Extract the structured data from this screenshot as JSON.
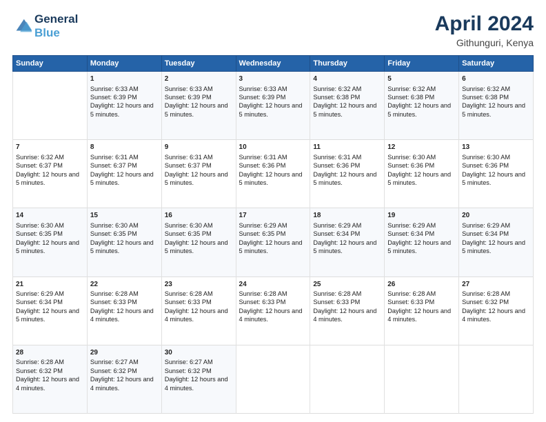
{
  "header": {
    "logo_line1": "General",
    "logo_line2": "Blue",
    "title": "April 2024",
    "subtitle": "Githunguri, Kenya"
  },
  "columns": [
    "Sunday",
    "Monday",
    "Tuesday",
    "Wednesday",
    "Thursday",
    "Friday",
    "Saturday"
  ],
  "weeks": [
    [
      {
        "day": "",
        "sunrise": "",
        "sunset": "",
        "daylight": ""
      },
      {
        "day": "1",
        "sunrise": "Sunrise: 6:33 AM",
        "sunset": "Sunset: 6:39 PM",
        "daylight": "Daylight: 12 hours and 5 minutes."
      },
      {
        "day": "2",
        "sunrise": "Sunrise: 6:33 AM",
        "sunset": "Sunset: 6:39 PM",
        "daylight": "Daylight: 12 hours and 5 minutes."
      },
      {
        "day": "3",
        "sunrise": "Sunrise: 6:33 AM",
        "sunset": "Sunset: 6:39 PM",
        "daylight": "Daylight: 12 hours and 5 minutes."
      },
      {
        "day": "4",
        "sunrise": "Sunrise: 6:32 AM",
        "sunset": "Sunset: 6:38 PM",
        "daylight": "Daylight: 12 hours and 5 minutes."
      },
      {
        "day": "5",
        "sunrise": "Sunrise: 6:32 AM",
        "sunset": "Sunset: 6:38 PM",
        "daylight": "Daylight: 12 hours and 5 minutes."
      },
      {
        "day": "6",
        "sunrise": "Sunrise: 6:32 AM",
        "sunset": "Sunset: 6:38 PM",
        "daylight": "Daylight: 12 hours and 5 minutes."
      }
    ],
    [
      {
        "day": "7",
        "sunrise": "Sunrise: 6:32 AM",
        "sunset": "Sunset: 6:37 PM",
        "daylight": "Daylight: 12 hours and 5 minutes."
      },
      {
        "day": "8",
        "sunrise": "Sunrise: 6:31 AM",
        "sunset": "Sunset: 6:37 PM",
        "daylight": "Daylight: 12 hours and 5 minutes."
      },
      {
        "day": "9",
        "sunrise": "Sunrise: 6:31 AM",
        "sunset": "Sunset: 6:37 PM",
        "daylight": "Daylight: 12 hours and 5 minutes."
      },
      {
        "day": "10",
        "sunrise": "Sunrise: 6:31 AM",
        "sunset": "Sunset: 6:36 PM",
        "daylight": "Daylight: 12 hours and 5 minutes."
      },
      {
        "day": "11",
        "sunrise": "Sunrise: 6:31 AM",
        "sunset": "Sunset: 6:36 PM",
        "daylight": "Daylight: 12 hours and 5 minutes."
      },
      {
        "day": "12",
        "sunrise": "Sunrise: 6:30 AM",
        "sunset": "Sunset: 6:36 PM",
        "daylight": "Daylight: 12 hours and 5 minutes."
      },
      {
        "day": "13",
        "sunrise": "Sunrise: 6:30 AM",
        "sunset": "Sunset: 6:36 PM",
        "daylight": "Daylight: 12 hours and 5 minutes."
      }
    ],
    [
      {
        "day": "14",
        "sunrise": "Sunrise: 6:30 AM",
        "sunset": "Sunset: 6:35 PM",
        "daylight": "Daylight: 12 hours and 5 minutes."
      },
      {
        "day": "15",
        "sunrise": "Sunrise: 6:30 AM",
        "sunset": "Sunset: 6:35 PM",
        "daylight": "Daylight: 12 hours and 5 minutes."
      },
      {
        "day": "16",
        "sunrise": "Sunrise: 6:30 AM",
        "sunset": "Sunset: 6:35 PM",
        "daylight": "Daylight: 12 hours and 5 minutes."
      },
      {
        "day": "17",
        "sunrise": "Sunrise: 6:29 AM",
        "sunset": "Sunset: 6:35 PM",
        "daylight": "Daylight: 12 hours and 5 minutes."
      },
      {
        "day": "18",
        "sunrise": "Sunrise: 6:29 AM",
        "sunset": "Sunset: 6:34 PM",
        "daylight": "Daylight: 12 hours and 5 minutes."
      },
      {
        "day": "19",
        "sunrise": "Sunrise: 6:29 AM",
        "sunset": "Sunset: 6:34 PM",
        "daylight": "Daylight: 12 hours and 5 minutes."
      },
      {
        "day": "20",
        "sunrise": "Sunrise: 6:29 AM",
        "sunset": "Sunset: 6:34 PM",
        "daylight": "Daylight: 12 hours and 5 minutes."
      }
    ],
    [
      {
        "day": "21",
        "sunrise": "Sunrise: 6:29 AM",
        "sunset": "Sunset: 6:34 PM",
        "daylight": "Daylight: 12 hours and 5 minutes."
      },
      {
        "day": "22",
        "sunrise": "Sunrise: 6:28 AM",
        "sunset": "Sunset: 6:33 PM",
        "daylight": "Daylight: 12 hours and 4 minutes."
      },
      {
        "day": "23",
        "sunrise": "Sunrise: 6:28 AM",
        "sunset": "Sunset: 6:33 PM",
        "daylight": "Daylight: 12 hours and 4 minutes."
      },
      {
        "day": "24",
        "sunrise": "Sunrise: 6:28 AM",
        "sunset": "Sunset: 6:33 PM",
        "daylight": "Daylight: 12 hours and 4 minutes."
      },
      {
        "day": "25",
        "sunrise": "Sunrise: 6:28 AM",
        "sunset": "Sunset: 6:33 PM",
        "daylight": "Daylight: 12 hours and 4 minutes."
      },
      {
        "day": "26",
        "sunrise": "Sunrise: 6:28 AM",
        "sunset": "Sunset: 6:33 PM",
        "daylight": "Daylight: 12 hours and 4 minutes."
      },
      {
        "day": "27",
        "sunrise": "Sunrise: 6:28 AM",
        "sunset": "Sunset: 6:32 PM",
        "daylight": "Daylight: 12 hours and 4 minutes."
      }
    ],
    [
      {
        "day": "28",
        "sunrise": "Sunrise: 6:28 AM",
        "sunset": "Sunset: 6:32 PM",
        "daylight": "Daylight: 12 hours and 4 minutes."
      },
      {
        "day": "29",
        "sunrise": "Sunrise: 6:27 AM",
        "sunset": "Sunset: 6:32 PM",
        "daylight": "Daylight: 12 hours and 4 minutes."
      },
      {
        "day": "30",
        "sunrise": "Sunrise: 6:27 AM",
        "sunset": "Sunset: 6:32 PM",
        "daylight": "Daylight: 12 hours and 4 minutes."
      },
      {
        "day": "",
        "sunrise": "",
        "sunset": "",
        "daylight": ""
      },
      {
        "day": "",
        "sunrise": "",
        "sunset": "",
        "daylight": ""
      },
      {
        "day": "",
        "sunrise": "",
        "sunset": "",
        "daylight": ""
      },
      {
        "day": "",
        "sunrise": "",
        "sunset": "",
        "daylight": ""
      }
    ]
  ]
}
